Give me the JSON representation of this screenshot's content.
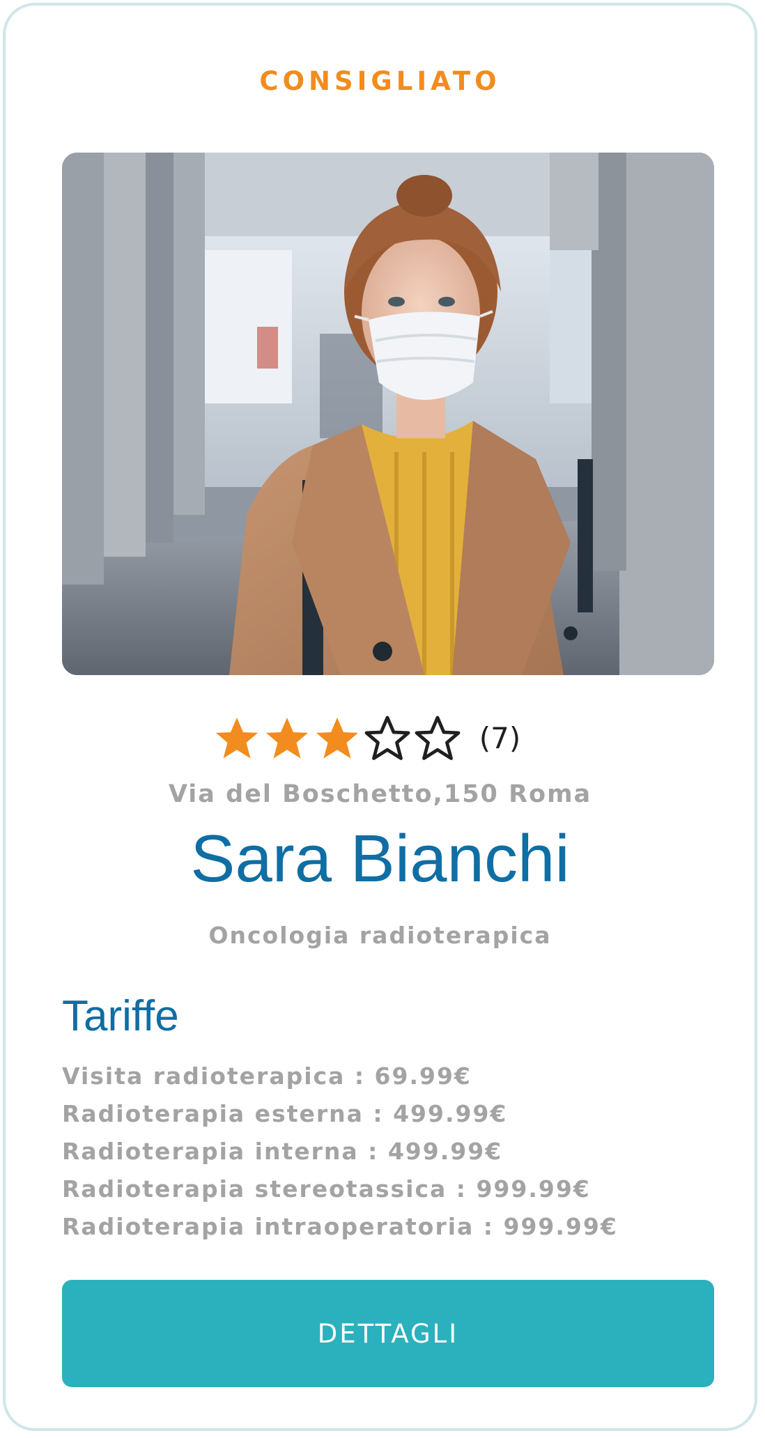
{
  "badge": "CONSIGLIATO",
  "rating": {
    "value": 3,
    "max": 5,
    "count_label": "(7)",
    "filled_color": "#f28c1e",
    "empty_color": "#1f1f1f"
  },
  "address": "Via del Boschetto,150 Roma",
  "doctor": {
    "name": "Sara Bianchi",
    "specialty": "Oncologia radioterapica"
  },
  "tariffe": {
    "title": "Tariffe",
    "items": [
      "Visita radioterapica : 69.99€",
      "Radioterapia esterna : 499.99€",
      "Radioterapia interna : 499.99€",
      "Radioterapia stereotassica : 999.99€",
      "Radioterapia intraoperatoria : 999.99€"
    ]
  },
  "button": {
    "label": "DETTAGLI"
  },
  "colors": {
    "accent": "#f28c1e",
    "primary": "#0f6ea3",
    "button": "#2bb1bd",
    "muted_text": "#a3a3a3",
    "card_border": "#cfe6ea"
  },
  "photo": {
    "icon": "doctor-photo"
  }
}
